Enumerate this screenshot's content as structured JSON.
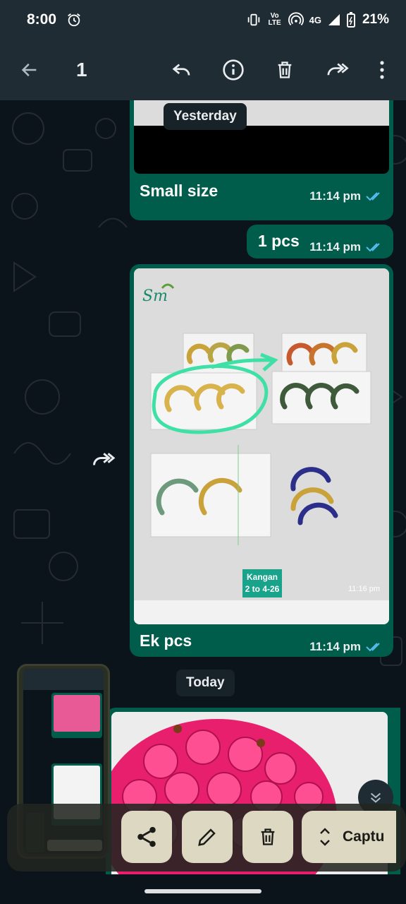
{
  "status_bar": {
    "time": "8:00",
    "network": "4G",
    "lte_label": "Vo LTE",
    "battery": "21%"
  },
  "app_bar": {
    "selected_count": "1",
    "icons": [
      "back-arrow-icon",
      "reply-icon",
      "info-icon",
      "delete-icon",
      "forward-icon",
      "more-options-icon"
    ]
  },
  "chat": {
    "messages": [
      {
        "type": "image",
        "caption": "Small size",
        "time": "11:14 pm",
        "status": "read"
      },
      {
        "type": "text",
        "text": "1 pcs",
        "time": "11:14 pm",
        "status": "read"
      },
      {
        "type": "image",
        "caption": "Ek pcs",
        "time": "11:14 pm",
        "status": "read",
        "image_overlay": {
          "tag_line1": "Kangan",
          "tag_line2": "2 to 4-26",
          "stamp_time": "11:16 pm"
        }
      },
      {
        "type": "image",
        "caption": "",
        "time": "",
        "status": ""
      }
    ],
    "date_chips": [
      "Yesterday",
      "Today"
    ]
  },
  "screenshot_toolbar": {
    "capture_label": "Captu",
    "buttons": [
      "share-icon",
      "edit-icon",
      "delete-icon",
      "expand-icon"
    ]
  },
  "colors": {
    "bubble_out": "#005c4b",
    "app_bar": "#1f2c33",
    "chat_bg": "#0b141a",
    "read_tick": "#53bdeb"
  }
}
